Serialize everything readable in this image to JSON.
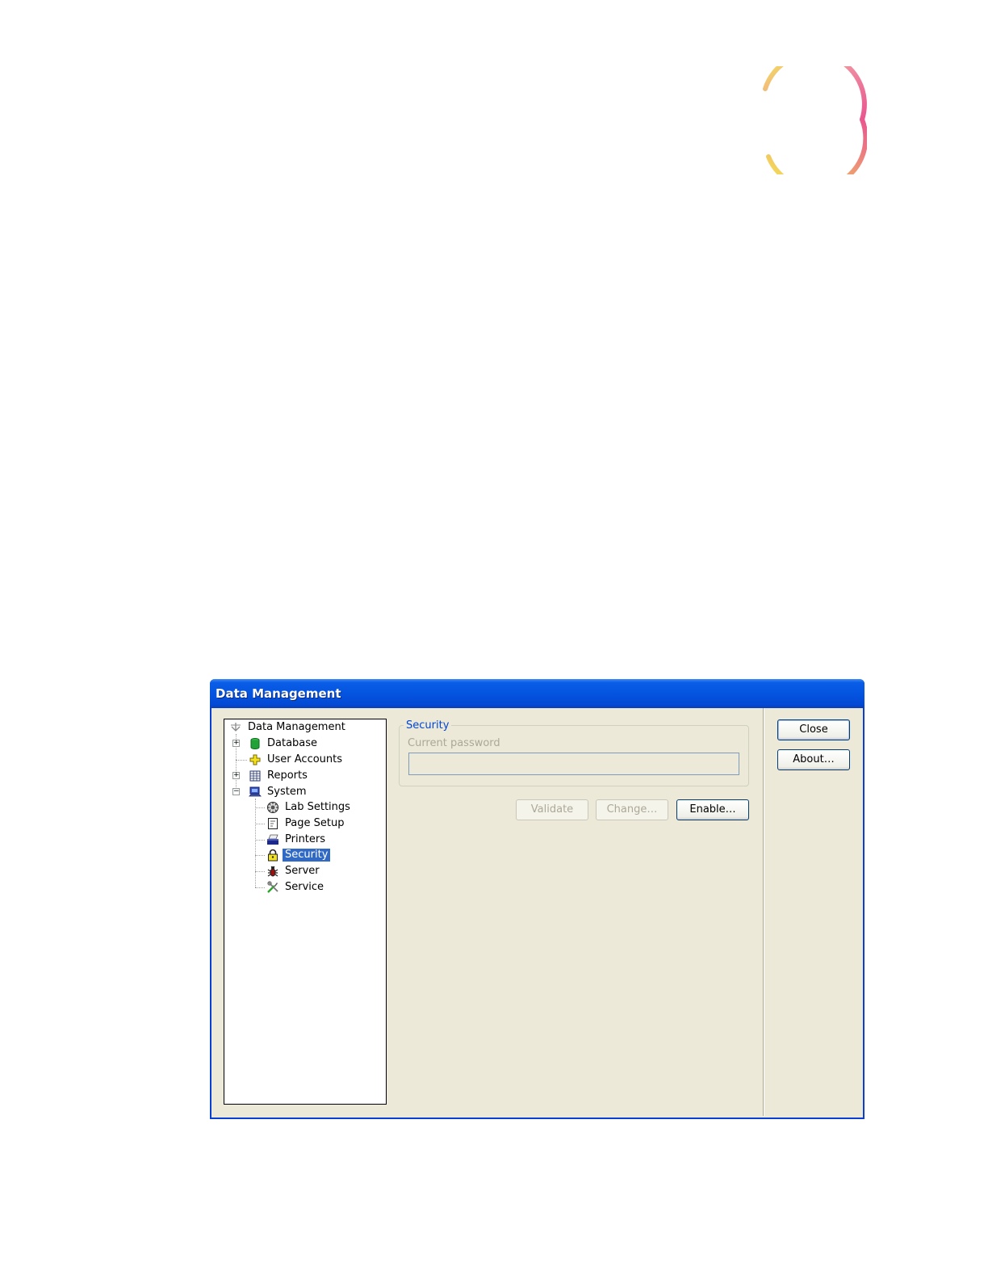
{
  "window": {
    "title": "Data Management"
  },
  "tree": {
    "root": "Data Management",
    "items": [
      {
        "label": "Database"
      },
      {
        "label": "User Accounts"
      },
      {
        "label": "Reports"
      },
      {
        "label": "System"
      },
      {
        "label": "Lab Settings"
      },
      {
        "label": "Page Setup"
      },
      {
        "label": "Printers"
      },
      {
        "label": "Security"
      },
      {
        "label": "Server"
      },
      {
        "label": "Service"
      }
    ]
  },
  "security": {
    "group_title": "Security",
    "current_password_label": "Current password",
    "current_password_value": ""
  },
  "buttons": {
    "validate": "Validate",
    "change": "Change…",
    "enable": "Enable…",
    "close": "Close",
    "about": "About…"
  },
  "colors": {
    "titlebar": "#0454e0",
    "selection": "#316ac5",
    "group_title": "#0046d5"
  }
}
